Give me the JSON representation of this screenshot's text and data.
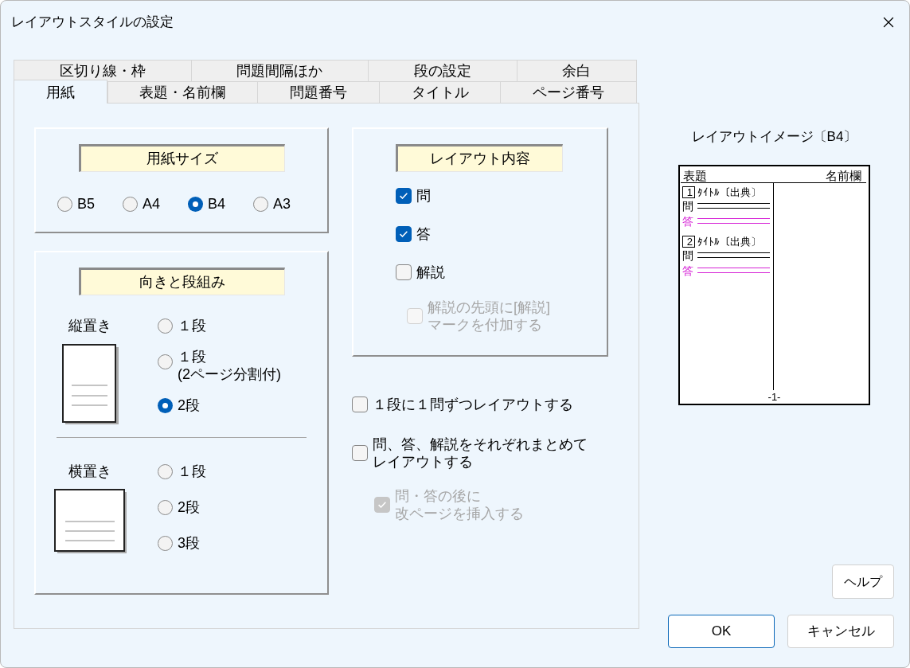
{
  "window": {
    "title": "レイアウトスタイルの設定"
  },
  "tab_rows": [
    {
      "tabs": [
        {
          "label": "区切り線・枠",
          "selected": false
        },
        {
          "label": "問題間隔ほか",
          "selected": false
        },
        {
          "label": "段の設定",
          "selected": false
        },
        {
          "label": "余白",
          "selected": false
        }
      ]
    },
    {
      "tabs": [
        {
          "label": "用紙",
          "selected": true
        },
        {
          "label": "表題・名前欄",
          "selected": false
        },
        {
          "label": "問題番号",
          "selected": false
        },
        {
          "label": "タイトル",
          "selected": false
        },
        {
          "label": "ページ番号",
          "selected": false
        }
      ]
    }
  ],
  "paper_size": {
    "header": "用紙サイズ",
    "options": [
      {
        "lines": [
          "B5"
        ],
        "selected": false
      },
      {
        "lines": [
          "A4"
        ],
        "selected": false
      },
      {
        "lines": [
          "B4"
        ],
        "selected": true
      },
      {
        "lines": [
          "A3"
        ],
        "selected": false
      }
    ]
  },
  "orientation": {
    "header": "向きと段組み",
    "groups": [
      {
        "kind": "portrait",
        "label": "縦置き",
        "options": [
          {
            "lines": [
              "１段"
            ],
            "selected": false
          },
          {
            "lines": [
              "１段",
              "(2ページ分割付)"
            ],
            "selected": false
          },
          {
            "lines": [
              "2段"
            ],
            "selected": true
          }
        ]
      },
      {
        "kind": "landscape",
        "label": "横置き",
        "options": [
          {
            "lines": [
              "１段"
            ],
            "selected": false
          },
          {
            "lines": [
              "2段"
            ],
            "selected": false
          },
          {
            "lines": [
              "3段"
            ],
            "selected": false
          }
        ]
      }
    ]
  },
  "layout_content": {
    "header": "レイアウト内容",
    "items": [
      {
        "lines": [
          "問"
        ],
        "checked": true,
        "disabled": false
      },
      {
        "lines": [
          "答"
        ],
        "checked": true,
        "disabled": false
      },
      {
        "lines": [
          "解説"
        ],
        "checked": false,
        "disabled": false,
        "children": [
          {
            "lines": [
              "解説の先頭に[解説]",
              "マークを付加する"
            ],
            "checked": false,
            "disabled": true
          }
        ]
      }
    ]
  },
  "layout_options": [
    {
      "lines": [
        "１段に１問ずつレイアウトする"
      ],
      "checked": false,
      "disabled": false
    },
    {
      "lines": [
        "問、答、解説をそれぞれまとめて",
        "レイアウトする"
      ],
      "checked": false,
      "disabled": false,
      "children": [
        {
          "lines": [
            "問・答の後に",
            "改ページを挿入する"
          ],
          "checked": true,
          "disabled": true
        }
      ]
    }
  ],
  "preview": {
    "title": "レイアウトイメージ〔B4〕",
    "heading_label": "表題",
    "name_label": "名前欄",
    "questions": [
      {
        "number": "1",
        "title": "ﾀｲﾄﾙ〔出典〕",
        "question_label": "問",
        "answer_label": "答"
      },
      {
        "number": "2",
        "title": "ﾀｲﾄﾙ〔出典〕",
        "question_label": "問",
        "answer_label": "答"
      }
    ],
    "page_number": "-1-"
  },
  "buttons": [
    {
      "kind": "help",
      "label": "ヘルプ",
      "default": false
    },
    {
      "kind": "ok",
      "label": "OK",
      "default": true
    },
    {
      "kind": "cancel",
      "label": "キャンセル",
      "default": false
    }
  ]
}
